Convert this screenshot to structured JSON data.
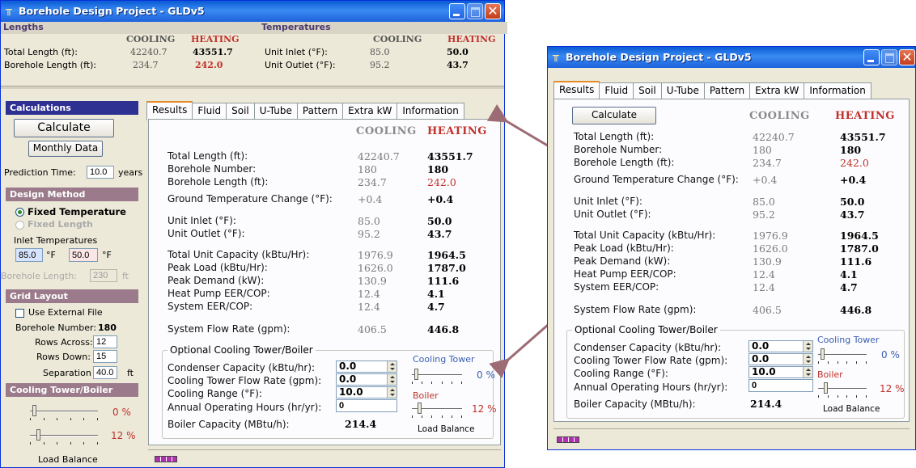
{
  "window": {
    "title": "Borehole Design Project - GLDv5"
  },
  "summary": {
    "lengths_header": "Lengths",
    "temperatures_header": "Temperatures",
    "cooling": "COOLING",
    "heating": "HEATING",
    "total_length_label": "Total Length (ft):",
    "total_length_cool": "42240.7",
    "total_length_heat": "43551.7",
    "borehole_length_label": "Borehole Length (ft):",
    "borehole_length_cool": "234.7",
    "borehole_length_heat": "242.0",
    "unit_inlet_label": "Unit Inlet (°F):",
    "unit_inlet_cool": "85.0",
    "unit_inlet_heat": "50.0",
    "unit_outlet_label": "Unit Outlet (°F):",
    "unit_outlet_cool": "95.2",
    "unit_outlet_heat": "43.7"
  },
  "sidebar": {
    "calculations": "Calculations",
    "calculate": "Calculate",
    "monthly_data": "Monthly Data",
    "prediction_time_label": "Prediction Time:",
    "prediction_time_value": "10.0",
    "prediction_time_unit": "years",
    "design_method": "Design Method",
    "fixed_temperature": "Fixed Temperature",
    "fixed_length": "Fixed Length",
    "inlet_temperatures": "Inlet Temperatures",
    "inlet_cool": "85.0",
    "inlet_heat": "50.0",
    "unit_f": "°F",
    "borehole_length_label": "Borehole Length:",
    "borehole_length_value": "230",
    "ft": "ft",
    "grid_layout": "Grid Layout",
    "use_external_file": "Use External File",
    "borehole_number_label": "Borehole Number:",
    "borehole_number_value": "180",
    "rows_across_label": "Rows Across:",
    "rows_across_value": "12",
    "rows_down_label": "Rows Down:",
    "rows_down_value": "15",
    "separation_label": "Separation",
    "separation_value": "40.0",
    "cooling_tower_boiler": "Cooling Tower/Boiler",
    "pct_tower": "0 %",
    "pct_boiler": "12 %",
    "load_balance": "Load Balance"
  },
  "tabs": [
    "Results",
    "Fluid",
    "Soil",
    "U-Tube",
    "Pattern",
    "Extra kW",
    "Information"
  ],
  "results": {
    "cooling": "COOLING",
    "heating": "HEATING",
    "calculate": "Calculate",
    "rows": {
      "total_length": {
        "label": "Total Length (ft):",
        "cool": "42240.7",
        "heat": "43551.7"
      },
      "borehole_number": {
        "label": "Borehole Number:",
        "cool": "180",
        "heat": "180"
      },
      "borehole_length": {
        "label": "Borehole Length (ft):",
        "cool": "234.7",
        "heat": "242.0"
      },
      "ground_temp_change": {
        "label": "Ground Temperature Change (°F):",
        "cool": "+0.4",
        "heat": "+0.4"
      },
      "unit_inlet": {
        "label": "Unit Inlet (°F):",
        "cool": "85.0",
        "heat": "50.0"
      },
      "unit_outlet": {
        "label": "Unit Outlet (°F):",
        "cool": "95.2",
        "heat": "43.7"
      },
      "total_unit_capacity": {
        "label": "Total Unit Capacity (kBtu/Hr):",
        "cool": "1976.9",
        "heat": "1964.5"
      },
      "peak_load": {
        "label": "Peak Load (kBtu/Hr):",
        "cool": "1626.0",
        "heat": "1787.0"
      },
      "peak_demand": {
        "label": "Peak Demand (kW):",
        "cool": "130.9",
        "heat": "111.6"
      },
      "heat_pump_eer": {
        "label": "Heat Pump EER/COP:",
        "cool": "12.4",
        "heat": "4.1"
      },
      "system_eer": {
        "label": "System EER/COP:",
        "cool": "12.4",
        "heat": "4.7"
      },
      "system_flow": {
        "label": "System Flow Rate (gpm):",
        "cool": "406.5",
        "heat": "446.8"
      }
    },
    "optional": {
      "title": "Optional Cooling Tower/Boiler",
      "condenser_capacity_label": "Condenser Capacity (kBtu/hr):",
      "condenser_capacity_value": "0.0",
      "tower_flow_label": "Cooling Tower Flow Rate (gpm):",
      "tower_flow_value": "0.0",
      "cooling_range_label": "Cooling Range (°F):",
      "cooling_range_value": "10.0",
      "annual_hours_label": "Annual Operating Hours (hr/yr):",
      "annual_hours_value": "0",
      "boiler_capacity_label": "Boiler Capacity (MBtu/h):",
      "boiler_capacity_value": "214.4",
      "cooling_tower": "Cooling Tower",
      "boiler": "Boiler",
      "pct_tower": "0 %",
      "pct_boiler": "12 %",
      "load_balance": "Load Balance"
    }
  },
  "colors": {
    "title_blue": "#0a5bd5",
    "heating_red": "#c0312b",
    "section_navy": "#2f3192",
    "section_mauve": "#9b7b8b",
    "progress": "#b030b0"
  }
}
